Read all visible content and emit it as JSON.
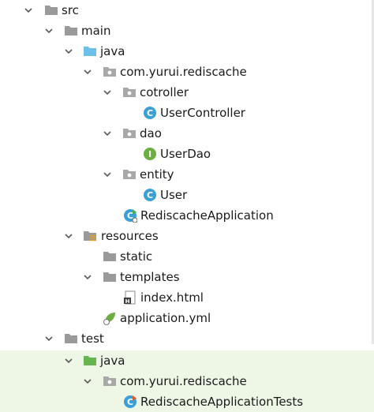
{
  "tree": {
    "src": "src",
    "main": "main",
    "java_main": "java",
    "pkg_main": "com.yurui.rediscache",
    "cotroller": "cotroller",
    "user_controller": "UserController",
    "dao": "dao",
    "user_dao": "UserDao",
    "entity": "entity",
    "user": "User",
    "app": "RediscacheApplication",
    "resources": "resources",
    "static": "static",
    "templates": "templates",
    "index_html": "index.html",
    "app_yml": "application.yml",
    "test": "test",
    "java_test": "java",
    "pkg_test": "com.yurui.rediscache",
    "app_tests": "RediscacheApplicationTests"
  },
  "icons": {
    "folder_gray": "folder-icon",
    "folder_blue": "source-folder-icon",
    "folder_green": "test-source-folder-icon",
    "package": "package-icon",
    "resources": "resources-folder-icon",
    "class": "class-icon",
    "interface": "interface-icon",
    "spring_boot_class": "spring-boot-class-icon",
    "html_file": "html-file-icon",
    "yml_file": "yml-file-icon",
    "chevron": "chevron-down-icon"
  },
  "colors": {
    "test_background": "#eef7e6",
    "class_icon": "#3b9fd8",
    "interface_icon": "#6aaf3f",
    "source_folder": "#6cbfe6",
    "test_folder": "#67b551",
    "folder_gray": "#9a9a9a"
  }
}
